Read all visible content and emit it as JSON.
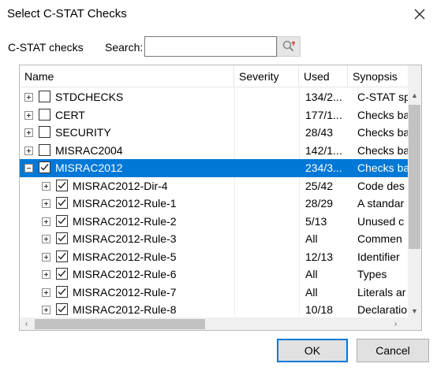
{
  "window": {
    "title": "Select C-STAT Checks"
  },
  "filter": {
    "checks_label": "C-STAT checks",
    "search_label": "Search:",
    "search_value": ""
  },
  "tree": {
    "columns": [
      "Name",
      "Severity",
      "Used",
      "Synopsis"
    ],
    "rows": [
      {
        "name": "STDCHECKS",
        "severity": "",
        "used": "134/2...",
        "synopsis": "C-STAT sp",
        "checked": false,
        "expanded": false,
        "level": 0,
        "selected": false
      },
      {
        "name": "CERT",
        "severity": "",
        "used": "177/1...",
        "synopsis": "Checks ba",
        "checked": false,
        "expanded": false,
        "level": 0,
        "selected": false
      },
      {
        "name": "SECURITY",
        "severity": "",
        "used": "28/43",
        "synopsis": "Checks ba",
        "checked": false,
        "expanded": false,
        "level": 0,
        "selected": false
      },
      {
        "name": "MISRAC2004",
        "severity": "",
        "used": "142/1...",
        "synopsis": "Checks ba",
        "checked": false,
        "expanded": false,
        "level": 0,
        "selected": false
      },
      {
        "name": "MISRAC2012",
        "severity": "",
        "used": "234/3...",
        "synopsis": "Checks ba",
        "checked": true,
        "expanded": true,
        "level": 0,
        "selected": true
      },
      {
        "name": "MISRAC2012-Dir-4",
        "severity": "",
        "used": "25/42",
        "synopsis": "Code des",
        "checked": true,
        "expanded": false,
        "level": 1,
        "selected": false
      },
      {
        "name": "MISRAC2012-Rule-1",
        "severity": "",
        "used": "28/29",
        "synopsis": "A standar",
        "checked": true,
        "expanded": false,
        "level": 1,
        "selected": false
      },
      {
        "name": "MISRAC2012-Rule-2",
        "severity": "",
        "used": "5/13",
        "synopsis": "Unused c",
        "checked": true,
        "expanded": false,
        "level": 1,
        "selected": false
      },
      {
        "name": "MISRAC2012-Rule-3",
        "severity": "",
        "used": "All",
        "synopsis": "Commen",
        "checked": true,
        "expanded": false,
        "level": 1,
        "selected": false
      },
      {
        "name": "MISRAC2012-Rule-5",
        "severity": "",
        "used": "12/13",
        "synopsis": "Identifier",
        "checked": true,
        "expanded": false,
        "level": 1,
        "selected": false
      },
      {
        "name": "MISRAC2012-Rule-6",
        "severity": "",
        "used": "All",
        "synopsis": "Types",
        "checked": true,
        "expanded": false,
        "level": 1,
        "selected": false
      },
      {
        "name": "MISRAC2012-Rule-7",
        "severity": "",
        "used": "All",
        "synopsis": "Literals ar",
        "checked": true,
        "expanded": false,
        "level": 1,
        "selected": false
      },
      {
        "name": "MISRAC2012-Rule-8",
        "severity": "",
        "used": "10/18",
        "synopsis": "Declaratio",
        "checked": true,
        "expanded": false,
        "level": 1,
        "selected": false
      }
    ]
  },
  "buttons": {
    "ok": "OK",
    "cancel": "Cancel"
  },
  "icons": {
    "close": "close-icon",
    "search": "search-icon",
    "expand": "plus-icon",
    "collapse": "minus-icon",
    "check": "checkmark-icon"
  },
  "colors": {
    "selection": "#0078d7",
    "button_bg": "#e1e1e1",
    "scroll_thumb": "#c2c2c2",
    "default_button_border": "#0078d7"
  }
}
